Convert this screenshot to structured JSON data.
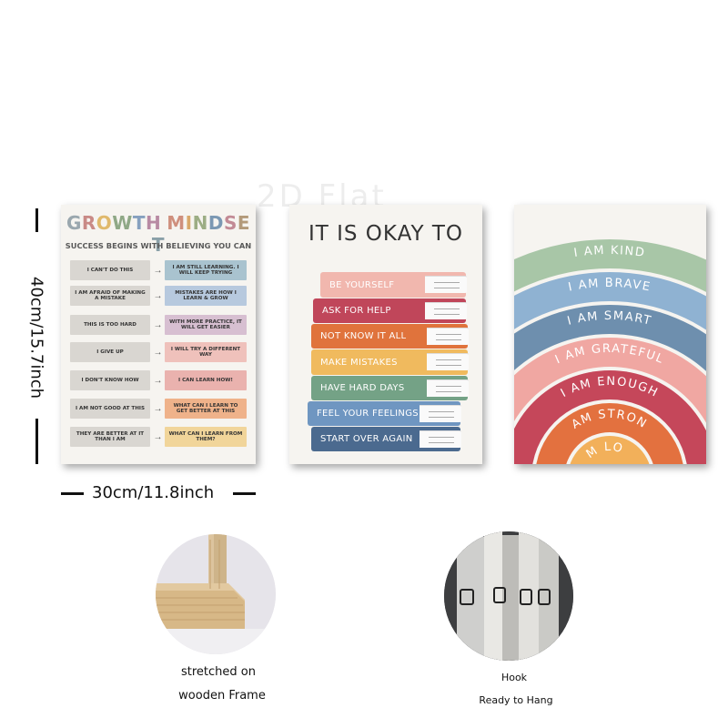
{
  "watermark": "2D Flat",
  "posters": {
    "growth": {
      "title_letters": [
        {
          "ch": "G",
          "color": "#9aa7ae"
        },
        {
          "ch": "R",
          "color": "#c98a86"
        },
        {
          "ch": "O",
          "color": "#e0b96c"
        },
        {
          "ch": "W",
          "color": "#8fa886"
        },
        {
          "ch": "T",
          "color": "#86a0bf"
        },
        {
          "ch": "H",
          "color": "#b88aa3"
        },
        {
          "ch": " ",
          "color": "#ffffff"
        },
        {
          "ch": "M",
          "color": "#cf8f7d"
        },
        {
          "ch": "I",
          "color": "#d9a86a"
        },
        {
          "ch": "N",
          "color": "#9cad84"
        },
        {
          "ch": "D",
          "color": "#7b98b3"
        },
        {
          "ch": "S",
          "color": "#c28a95"
        },
        {
          "ch": "E",
          "color": "#b39a7a"
        },
        {
          "ch": "T",
          "color": "#8aa0a8"
        }
      ],
      "subtitle": "SUCCESS BEGINS WITH BELIEVING YOU CAN",
      "rows": [
        {
          "left": "I CAN'T DO THIS",
          "right": "I AM STILL LEARNING. I WILL KEEP TRYING",
          "color": "#a9c3cf"
        },
        {
          "left": "I AM AFRAID OF MAKING A MISTAKE",
          "right": "MISTAKES ARE HOW I LEARN & GROW",
          "color": "#b7c9de"
        },
        {
          "left": "THIS IS TOO HARD",
          "right": "WITH MORE PRACTICE, IT WILL GET EASIER",
          "color": "#d7bfd1"
        },
        {
          "left": "I GIVE UP",
          "right": "I WILL TRY A DIFFERENT WAY",
          "color": "#efc1bb"
        },
        {
          "left": "I DON'T KNOW HOW",
          "right": "I CAN LEARN HOW!",
          "color": "#eab2ae"
        },
        {
          "left": "I AM NOT GOOD AT THIS",
          "right": "WHAT CAN I LEARN TO GET BETTER AT THIS",
          "color": "#efb28a"
        },
        {
          "left": "THEY ARE BETTER AT IT THAN I AM",
          "right": "WHAT CAN I LEARN FROM THEM?",
          "color": "#f1d59a"
        }
      ]
    },
    "okay": {
      "title": "IT IS OKAY TO",
      "books": [
        {
          "label": "BE YOURSELF",
          "color": "#f1b7ae"
        },
        {
          "label": "ASK FOR HELP",
          "color": "#c0465a"
        },
        {
          "label": "NOT KNOW IT ALL",
          "color": "#e0733c"
        },
        {
          "label": "MAKE MISTAKES",
          "color": "#f0ba5e"
        },
        {
          "label": "HAVE HARD DAYS",
          "color": "#74a286"
        },
        {
          "label": "FEEL YOUR FEELINGS",
          "color": "#6f96c1"
        },
        {
          "label": "START OVER AGAIN",
          "color": "#4b6a8f"
        }
      ]
    },
    "rainbow": {
      "bands": [
        {
          "label": "I AM KIND",
          "color": "#a8c6a7"
        },
        {
          "label": "I AM BRAVE",
          "color": "#8fb2d2"
        },
        {
          "label": "I AM SMART",
          "color": "#6e8fae"
        },
        {
          "label": "I AM GRATEFUL",
          "color": "#f0a7a2"
        },
        {
          "label": "I AM ENOUGH",
          "color": "#c5475a"
        },
        {
          "label": "I AM STRONG",
          "color": "#e3713f"
        },
        {
          "label": "I AM LOVED",
          "color": "#f2b05a"
        }
      ]
    }
  },
  "dimensions": {
    "height": "40cm/15.7inch",
    "width": "30cm/11.8inch"
  },
  "features": {
    "frame_caption_1": "stretched on",
    "frame_caption_2": "wooden Frame",
    "hook_caption_1": "Hook",
    "hook_caption_2": "Ready to Hang"
  }
}
